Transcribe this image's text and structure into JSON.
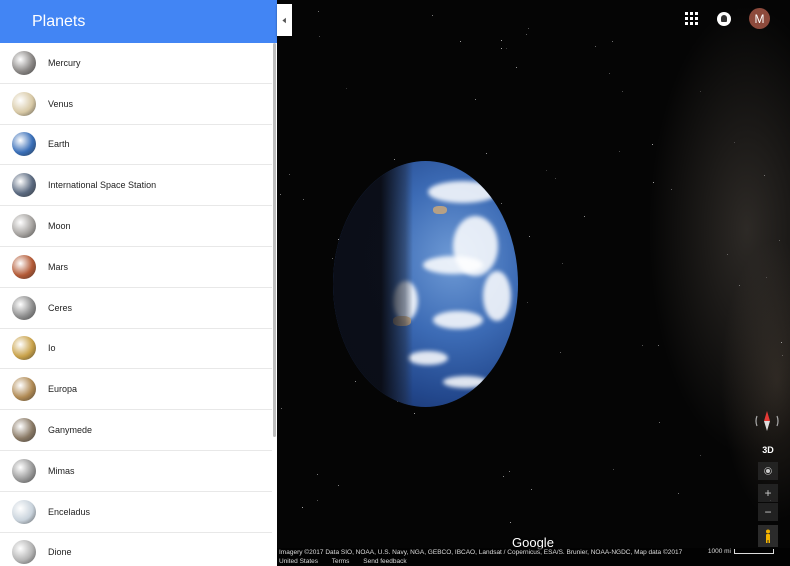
{
  "sidebar": {
    "title": "Planets",
    "items": [
      {
        "label": "Mercury",
        "color": "#8b8886"
      },
      {
        "label": "Venus",
        "color": "#d8c9a6"
      },
      {
        "label": "Earth",
        "color": "#3a6fb8"
      },
      {
        "label": "International Space Station",
        "color": "#5b6a80"
      },
      {
        "label": "Moon",
        "color": "#a6a3a0"
      },
      {
        "label": "Mars",
        "color": "#b35a36"
      },
      {
        "label": "Ceres",
        "color": "#8f8f8f"
      },
      {
        "label": "Io",
        "color": "#c9a24a"
      },
      {
        "label": "Europa",
        "color": "#b08a54"
      },
      {
        "label": "Ganymede",
        "color": "#8a7a66"
      },
      {
        "label": "Mimas",
        "color": "#9a9a9a"
      },
      {
        "label": "Enceladus",
        "color": "#c9d3dc"
      },
      {
        "label": "Dione",
        "color": "#b5b5b5"
      }
    ]
  },
  "header": {
    "avatar_initial": "M"
  },
  "controls": {
    "three_d_label": "3D",
    "zoom_in_label": "+",
    "zoom_out_label": "−"
  },
  "footer": {
    "logo": "Google",
    "attribution": "Imagery ©2017 Data SIO, NOAA, U.S. Navy, NGA, GEBCO, IBCAO, Landsat / Copernicus, ESA/S. Brunier, NOAA-NGDC, Map data ©2017",
    "country": "United States",
    "terms": "Terms",
    "feedback": "Send feedback",
    "scale": "1000 mi"
  },
  "colors": {
    "header_blue": "#4285f4"
  }
}
